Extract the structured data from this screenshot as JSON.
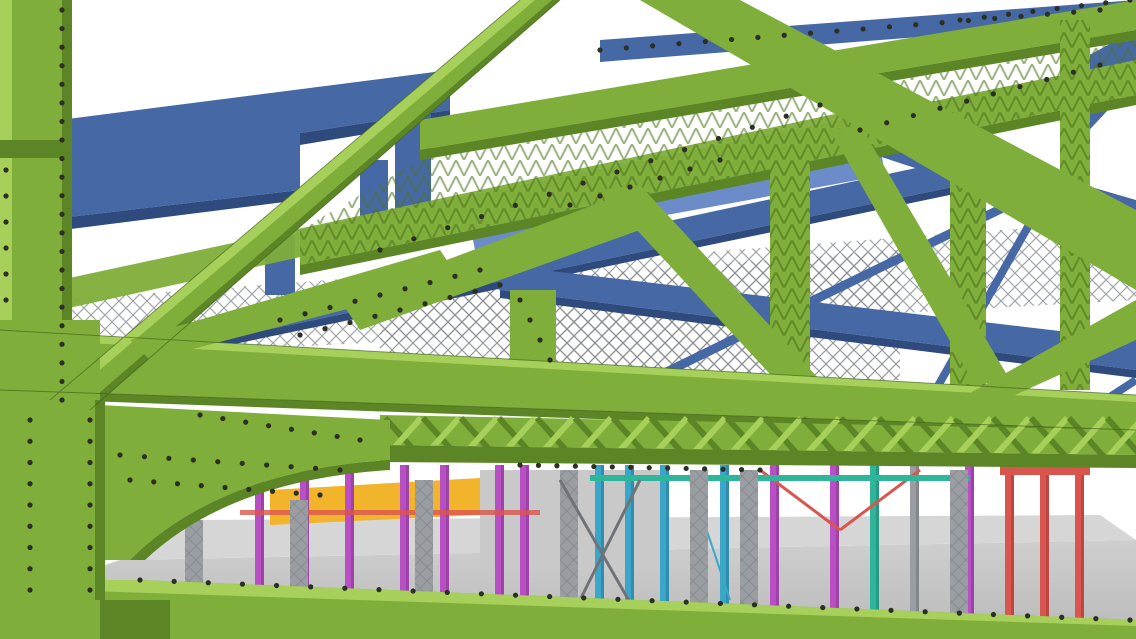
{
  "scene": {
    "description_free": true,
    "colors": {
      "sky": "#ffffff",
      "floor": "#d9d9d9",
      "floor_dark": "#c2c2c2",
      "green": "#7fae3a",
      "green_light": "#a7d05a",
      "green_dark": "#5c8626",
      "green_edge": "#3e5c18",
      "blue": "#4669a6",
      "blue_light": "#6b8cc8",
      "blue_dark": "#2f4a7c",
      "gray": "#9a9ea3",
      "gray_dark": "#6f7378",
      "yellow": "#f2b42a",
      "magenta": "#b84fc4",
      "pink": "#e0409a",
      "red": "#d9554d",
      "cyan": "#3aa6c9",
      "teal": "#2fb59a",
      "bolt": "#2b2f24"
    },
    "icons": [
      "steel-truss-render"
    ]
  }
}
